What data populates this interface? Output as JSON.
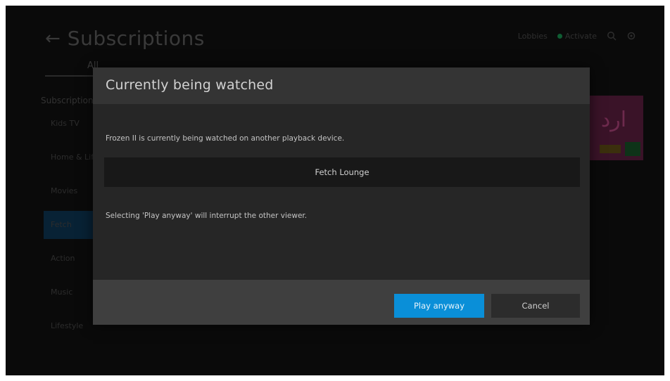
{
  "background": {
    "title": "Subscriptions",
    "top_right": {
      "item1": "Lobbies",
      "item2": "Activate"
    },
    "tab_all": "All",
    "sidebar_heading": "Subscriptions",
    "sidebar_items": [
      {
        "label": "Kids TV"
      },
      {
        "label": "Home & Lifestyle"
      },
      {
        "label": "Movies"
      },
      {
        "label": "Fetch"
      },
      {
        "label": "Action"
      },
      {
        "label": "Music"
      },
      {
        "label": "Lifestyle"
      }
    ],
    "thumb_text": "ارد",
    "selected_index": 3
  },
  "modal": {
    "title": "Currently being watched",
    "message": "Frozen II is currently being watched on another playback device.",
    "device_name": "Fetch Lounge",
    "warning": "Selecting 'Play anyway' will interrupt the other viewer.",
    "play_label": "Play anyway",
    "cancel_label": "Cancel"
  },
  "colors": {
    "accent": "#0a8fd8",
    "modal_bg": "#262626",
    "footer_bg": "#3f3f3f"
  }
}
